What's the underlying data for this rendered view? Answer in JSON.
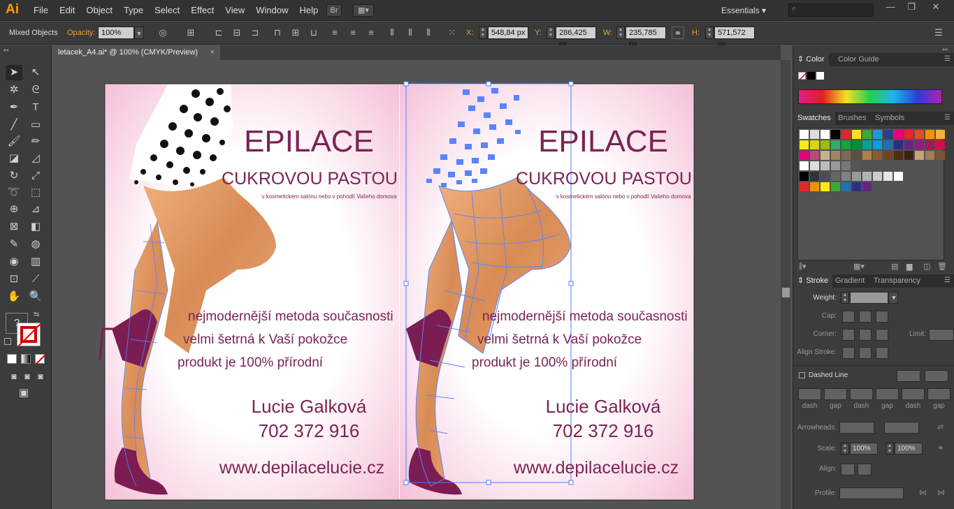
{
  "app": {
    "logo": "Ai",
    "menus": [
      "File",
      "Edit",
      "Object",
      "Type",
      "Select",
      "Effect",
      "View",
      "Window",
      "Help"
    ],
    "bridge_label": "Br",
    "workspace": "Essentials",
    "search_placeholder": ""
  },
  "control": {
    "selection": "Mixed Objects",
    "opacity_label": "Opacity:",
    "opacity_value": "100%",
    "x_label": "X:",
    "x_value": "548,84 px",
    "y_label": "Y:",
    "y_value": "286,425 px",
    "w_label": "W:",
    "w_value": "235,785 px",
    "h_label": "H:",
    "h_value": "571,572 px"
  },
  "document": {
    "tab_title": "letacek_A4.ai* @ 100% (CMYK/Preview)"
  },
  "flyer": {
    "title": "EPILACE",
    "subtitle": "CUKROVOU PASTOU",
    "tagline": "v kosmetickém salónu nebo v pohodlí Vašeho domova",
    "line1": "nejmodernější metoda současnosti",
    "line2": "velmi šetrná k Vaší pokožce",
    "line3": "produkt je 100% přírodní",
    "name": "Lucie Galková",
    "phone": "702 372 916",
    "web": "www.depilacelucie.cz"
  },
  "colors": {
    "accent": "#ff9a00",
    "flyer_text": "#7b2453",
    "shoe": "#7b1d52",
    "skin": "#e09a66",
    "selection": "#4f7cff"
  },
  "panels": {
    "color_tabs": [
      "Color",
      "Color Guide"
    ],
    "swatch_tabs": [
      "Swatches",
      "Brushes",
      "Symbols"
    ],
    "stroke_tabs": [
      "Stroke",
      "Gradient",
      "Transparency"
    ],
    "weight_label": "Weight:",
    "cap_label": "Cap:",
    "corner_label": "Corner:",
    "limit_label": "Limit:",
    "align_label": "Align Stroke:",
    "dashed_label": "Dashed Line",
    "dash_labels": [
      "dash",
      "gap",
      "dash",
      "gap",
      "dash",
      "gap"
    ],
    "arrowheads_label": "Arrowheads:",
    "scale_label": "Scale:",
    "scale1": "100%",
    "scale2": "100%",
    "align2_label": "Align:",
    "profile_label": "Profile:"
  }
}
